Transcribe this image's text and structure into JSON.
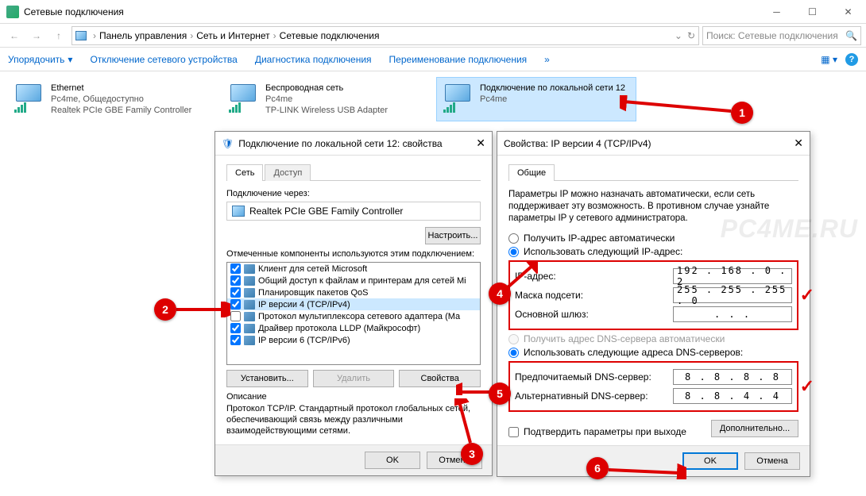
{
  "window": {
    "title": "Сетевые подключения"
  },
  "breadcrumb": {
    "a": "Панель управления",
    "b": "Сеть и Интернет",
    "c": "Сетевые подключения"
  },
  "search": {
    "placeholder": "Поиск: Сетевые подключения"
  },
  "toolbar": {
    "organize": "Упорядочить",
    "disable": "Отключение сетевого устройства",
    "diag": "Диагностика подключения",
    "rename": "Переименование подключения"
  },
  "conns": [
    {
      "name": "Ethernet",
      "sub1": "Pc4me, Общедоступно",
      "sub2": "Realtek PCIe GBE Family Controller"
    },
    {
      "name": "Беспроводная сеть",
      "sub1": "Pc4me",
      "sub2": "TP-LINK Wireless USB Adapter"
    },
    {
      "name": "Подключение по локальной сети 12",
      "sub1": "Pc4me",
      "sub2": ""
    }
  ],
  "dlg1": {
    "title": "Подключение по локальной сети 12: свойства",
    "tab_net": "Сеть",
    "tab_access": "Доступ",
    "connect_via": "Подключение через:",
    "adapter": "Realtek PCIe GBE Family Controller",
    "configure": "Настроить...",
    "components_label": "Отмеченные компоненты используются этим подключением:",
    "items": [
      "Клиент для сетей Microsoft",
      "Общий доступ к файлам и принтерам для сетей Mi",
      "Планировщик пакетов QoS",
      "IP версии 4 (TCP/IPv4)",
      "Протокол мультиплексора сетевого адаптера (Ма",
      "Драйвер протокола LLDP (Майкрософт)",
      "IP версии 6 (TCP/IPv6)"
    ],
    "install": "Установить...",
    "remove": "Удалить",
    "props": "Свойства",
    "desc_title": "Описание",
    "desc": "Протокол TCP/IP. Стандартный протокол глобальных сетей, обеспечивающий связь между различными взаимодействующими сетями.",
    "ok": "OK",
    "cancel": "Отмена"
  },
  "dlg2": {
    "title": "Свойства: IP версии 4 (TCP/IPv4)",
    "tab": "Общие",
    "intro": "Параметры IP можно назначать автоматически, если сеть поддерживает эту возможность. В противном случае узнайте параметры IP у сетевого администратора.",
    "auto_ip": "Получить IP-адрес автоматически",
    "manual_ip": "Использовать следующий IP-адрес:",
    "ip_label": "IP-адрес:",
    "ip_val": "192 . 168 .  0  .  2",
    "mask_label": "Маска подсети:",
    "mask_val": "255 . 255 . 255 .  0",
    "gw_label": "Основной шлюз:",
    "gw_val": ".       .       .",
    "auto_dns": "Получить адрес DNS-сервера автоматически",
    "manual_dns": "Использовать следующие адреса DNS-серверов:",
    "dns1_label": "Предпочитаемый DNS-сервер:",
    "dns1_val": "8  .  8  .  8  .  8",
    "dns2_label": "Альтернативный DNS-сервер:",
    "dns2_val": "8  .  8  .  4  .  4",
    "validate": "Подтвердить параметры при выходе",
    "advanced": "Дополнительно...",
    "ok": "OK",
    "cancel": "Отмена"
  },
  "watermark": "PC4ME.RU"
}
